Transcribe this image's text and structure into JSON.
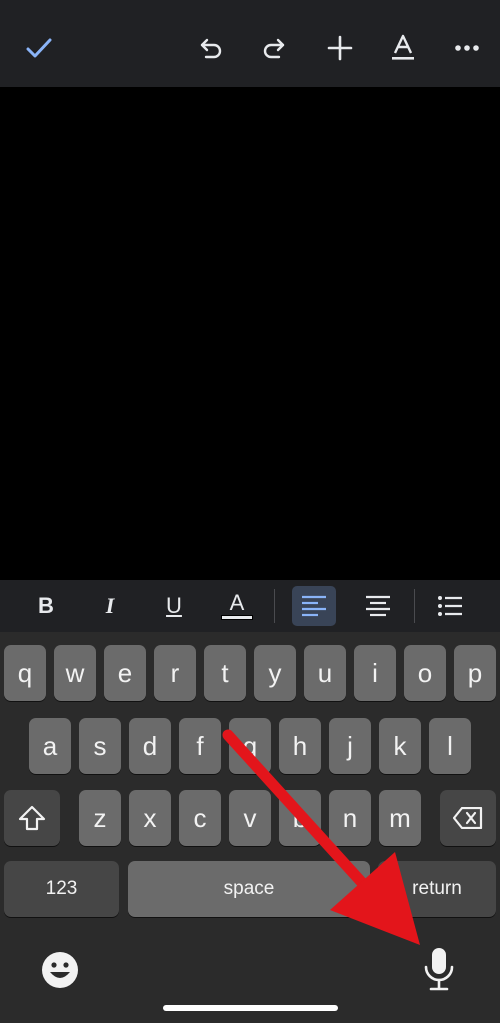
{
  "toolbar": {
    "done_icon": "check-icon",
    "undo_icon": "undo-icon",
    "redo_icon": "redo-icon",
    "insert_icon": "plus-icon",
    "text_format_icon": "text-format-icon",
    "more_icon": "more-horizontal-icon"
  },
  "format_bar": {
    "bold": "B",
    "italic": "I",
    "underline": "U",
    "text_color": "A",
    "align_left_icon": "align-left-icon",
    "align_center_icon": "align-center-icon",
    "list_icon": "bulleted-list-icon",
    "active_color": "#394457"
  },
  "keyboard": {
    "row1": [
      "q",
      "w",
      "e",
      "r",
      "t",
      "y",
      "u",
      "i",
      "o",
      "p"
    ],
    "row2": [
      "a",
      "s",
      "d",
      "f",
      "g",
      "h",
      "j",
      "k",
      "l"
    ],
    "row3": [
      "z",
      "x",
      "c",
      "v",
      "b",
      "n",
      "m"
    ],
    "numbers_label": "123",
    "space_label": "space",
    "return_label": "return",
    "shift_icon": "shift-icon",
    "delete_icon": "backspace-icon",
    "emoji_icon": "emoji-icon",
    "dictation_icon": "microphone-icon"
  },
  "colors": {
    "accent": "#8ab4f8",
    "annotation_arrow": "#e3151b"
  }
}
